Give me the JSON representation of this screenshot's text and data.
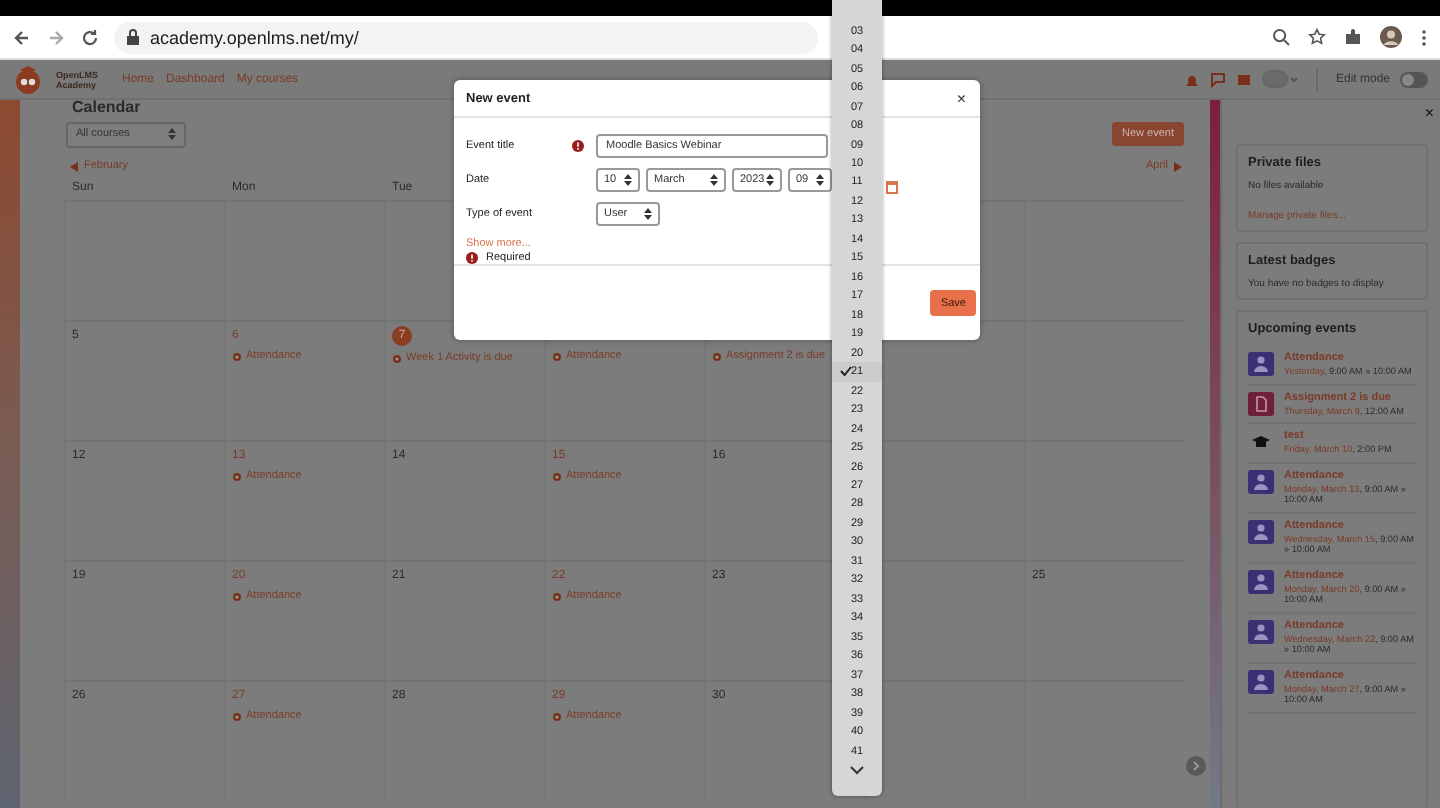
{
  "browser": {
    "url": "academy.openlms.net/my/"
  },
  "navbar": {
    "logo_lines": [
      "OpenLMS",
      "Academy"
    ],
    "links": [
      "Home",
      "Dashboard",
      "My courses"
    ],
    "edit_mode": {
      "label": "Edit mode",
      "on": false
    }
  },
  "calendar": {
    "heading": "Calendar",
    "course_filter": "All courses",
    "new_event_button": "New event",
    "prev_month": "February",
    "next_month": "April",
    "weekdays": [
      "Sun",
      "Mon",
      "Tue"
    ],
    "weeks": [
      [
        {
          "kind": "day",
          "day": "5"
        },
        {
          "kind": "day",
          "day": "6",
          "events": [
            "Attendance"
          ]
        },
        {
          "kind": "day",
          "day": "7",
          "today": true,
          "events": [
            "Week 1 Activity is due"
          ]
        },
        {
          "kind": "day",
          "events": [
            "Attendance"
          ]
        },
        {
          "kind": "day",
          "events": [
            "Assignment 2 is due"
          ]
        }
      ],
      [
        {
          "kind": "day",
          "day": "12"
        },
        {
          "kind": "day",
          "day": "13",
          "events": [
            "Attendance"
          ]
        },
        {
          "kind": "day",
          "day": "14"
        },
        {
          "kind": "day",
          "day": "15",
          "events": [
            "Attendance"
          ]
        },
        {
          "kind": "day",
          "day": "16"
        }
      ],
      [
        {
          "kind": "day",
          "day": "19"
        },
        {
          "kind": "day",
          "day": "20",
          "events": [
            "Attendance"
          ]
        },
        {
          "kind": "day",
          "day": "21"
        },
        {
          "kind": "day",
          "day": "22",
          "events": [
            "Attendance"
          ]
        },
        {
          "kind": "day",
          "day": "23"
        },
        {
          "kind": "covered"
        },
        {
          "kind": "day",
          "day": "25"
        }
      ],
      [
        {
          "kind": "day",
          "day": "26"
        },
        {
          "kind": "day",
          "day": "27",
          "events": [
            "Attendance"
          ]
        },
        {
          "kind": "day",
          "day": "28"
        },
        {
          "kind": "day",
          "day": "29",
          "events": [
            "Attendance"
          ]
        },
        {
          "kind": "day",
          "day": "30"
        }
      ]
    ]
  },
  "modal": {
    "title": "New event",
    "close_label": "×",
    "fields": [
      {
        "kind": "text",
        "label": "Event title",
        "required": true,
        "value": "Moodle Basics Webinar"
      },
      {
        "kind": "date",
        "label": "Date",
        "required": false,
        "selects": [
          "10",
          "March",
          "2023",
          "09"
        ]
      },
      {
        "kind": "select",
        "label": "Type of event",
        "required": false,
        "value": "User"
      }
    ],
    "show_more": "Show more...",
    "required_note": "Required",
    "save_button": "Save"
  },
  "dropdown": {
    "options": [
      {
        "label": "03",
        "selected": false
      },
      {
        "label": "04",
        "selected": false
      },
      {
        "label": "05",
        "selected": false
      },
      {
        "label": "06",
        "selected": false
      },
      {
        "label": "07",
        "selected": false
      },
      {
        "label": "08",
        "selected": false
      },
      {
        "label": "09",
        "selected": false
      },
      {
        "label": "10",
        "selected": false
      },
      {
        "label": "11",
        "selected": false
      },
      {
        "label": "12",
        "selected": false
      },
      {
        "label": "13",
        "selected": false
      },
      {
        "label": "14",
        "selected": false
      },
      {
        "label": "15",
        "selected": false
      },
      {
        "label": "16",
        "selected": false
      },
      {
        "label": "17",
        "selected": false
      },
      {
        "label": "18",
        "selected": false
      },
      {
        "label": "19",
        "selected": false
      },
      {
        "label": "20",
        "selected": false
      },
      {
        "label": "21",
        "selected": true
      },
      {
        "label": "22",
        "selected": false
      },
      {
        "label": "23",
        "selected": false
      },
      {
        "label": "24",
        "selected": false
      },
      {
        "label": "25",
        "selected": false
      },
      {
        "label": "26",
        "selected": false
      },
      {
        "label": "27",
        "selected": false
      },
      {
        "label": "28",
        "selected": false
      },
      {
        "label": "29",
        "selected": false
      },
      {
        "label": "30",
        "selected": false
      },
      {
        "label": "31",
        "selected": false
      },
      {
        "label": "32",
        "selected": false
      },
      {
        "label": "33",
        "selected": false
      },
      {
        "label": "34",
        "selected": false
      },
      {
        "label": "35",
        "selected": false
      },
      {
        "label": "36",
        "selected": false
      },
      {
        "label": "37",
        "selected": false
      },
      {
        "label": "38",
        "selected": false
      },
      {
        "label": "39",
        "selected": false
      },
      {
        "label": "40",
        "selected": false
      },
      {
        "label": "41",
        "selected": false
      }
    ]
  },
  "sidebar": {
    "close_label": "×",
    "private_files": {
      "title": "Private files",
      "text": "No files available",
      "link": "Manage private files..."
    },
    "badges": {
      "title": "Latest badges",
      "text": "You have no badges to display"
    },
    "upcoming": {
      "title": "Upcoming events",
      "events": [
        {
          "kind": "attendance",
          "title": "Attendance",
          "date": "Yesterday",
          "time": ", 9:00 AM » 10:00 AM"
        },
        {
          "kind": "assignment",
          "title": "Assignment 2 is due",
          "date": "Thursday, March 9",
          "time": ", 12:00 AM"
        },
        {
          "kind": "course",
          "title": "test",
          "date": "Friday, March 10",
          "time": ", 2:00 PM"
        },
        {
          "kind": "attendance",
          "title": "Attendance",
          "date": "Monday, March 13",
          "time": ", 9:00 AM » 10:00 AM"
        },
        {
          "kind": "attendance",
          "title": "Attendance",
          "date": "Wednesday, March 15",
          "time": ", 9:00 AM » 10:00 AM"
        },
        {
          "kind": "attendance",
          "title": "Attendance",
          "date": "Monday, March 20",
          "time": ", 9:00 AM » 10:00 AM"
        },
        {
          "kind": "attendance",
          "title": "Attendance",
          "date": "Wednesday, March 22",
          "time": ", 9:00 AM » 10:00 AM"
        },
        {
          "kind": "attendance",
          "title": "Attendance",
          "date": "Monday, March 27",
          "time": ", 9:00 AM » 10:00 AM"
        }
      ]
    }
  }
}
